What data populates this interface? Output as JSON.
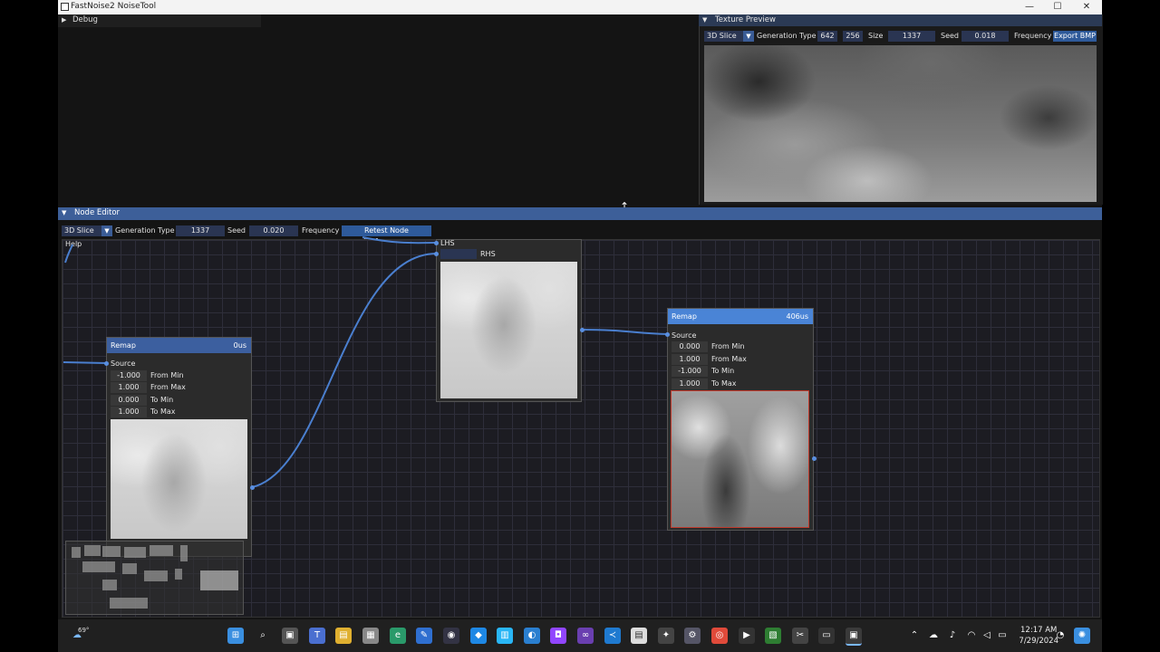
{
  "window": {
    "title": "FastNoise2 NoiseTool",
    "minimize": "—",
    "maximize": "☐",
    "close": "✕"
  },
  "debug": {
    "label": "Debug",
    "arrow": "▶"
  },
  "texture_preview": {
    "label": "Texture Preview",
    "arrow": "▼",
    "mode": "3D Slice",
    "generation_type_label": "Generation Type",
    "width": "642",
    "height": "256",
    "size_label": "Size",
    "seed": "1337",
    "seed_label": "Seed",
    "frequency": "0.018",
    "frequency_label": "Frequency",
    "export_label": "Export BMP"
  },
  "node_editor": {
    "label": "Node Editor",
    "arrow": "▼",
    "mode": "3D Slice",
    "generation_type_label": "Generation Type",
    "seed": "1337",
    "seed_label": "Seed",
    "frequency": "0.020",
    "frequency_label": "Frequency",
    "retest_label": "Retest Node Performance",
    "help": "Help"
  },
  "nodes": {
    "remap_left": {
      "title": "Remap",
      "time": "0us",
      "source_label": "Source",
      "rows": [
        {
          "value": "-1.000",
          "name": "From Min"
        },
        {
          "value": "1.000",
          "name": "From Max"
        },
        {
          "value": "0.000",
          "name": "To Min"
        },
        {
          "value": "1.000",
          "name": "To Max"
        }
      ]
    },
    "middle": {
      "lhs": "LHS",
      "rhs": "RHS"
    },
    "remap_right": {
      "title": "Remap",
      "time": "406us",
      "source_label": "Source",
      "rows": [
        {
          "value": "0.000",
          "name": "From Min"
        },
        {
          "value": "1.000",
          "name": "From Max"
        },
        {
          "value": "-1.000",
          "name": "To Min"
        },
        {
          "value": "1.000",
          "name": "To Max"
        }
      ]
    }
  },
  "taskbar": {
    "weather": "69°",
    "time": "12:17 AM",
    "date": "7/29/2024"
  },
  "colors": {
    "accent": "#3d5f99",
    "wire": "#4a7fcf",
    "selected_border": "#c0392b"
  }
}
